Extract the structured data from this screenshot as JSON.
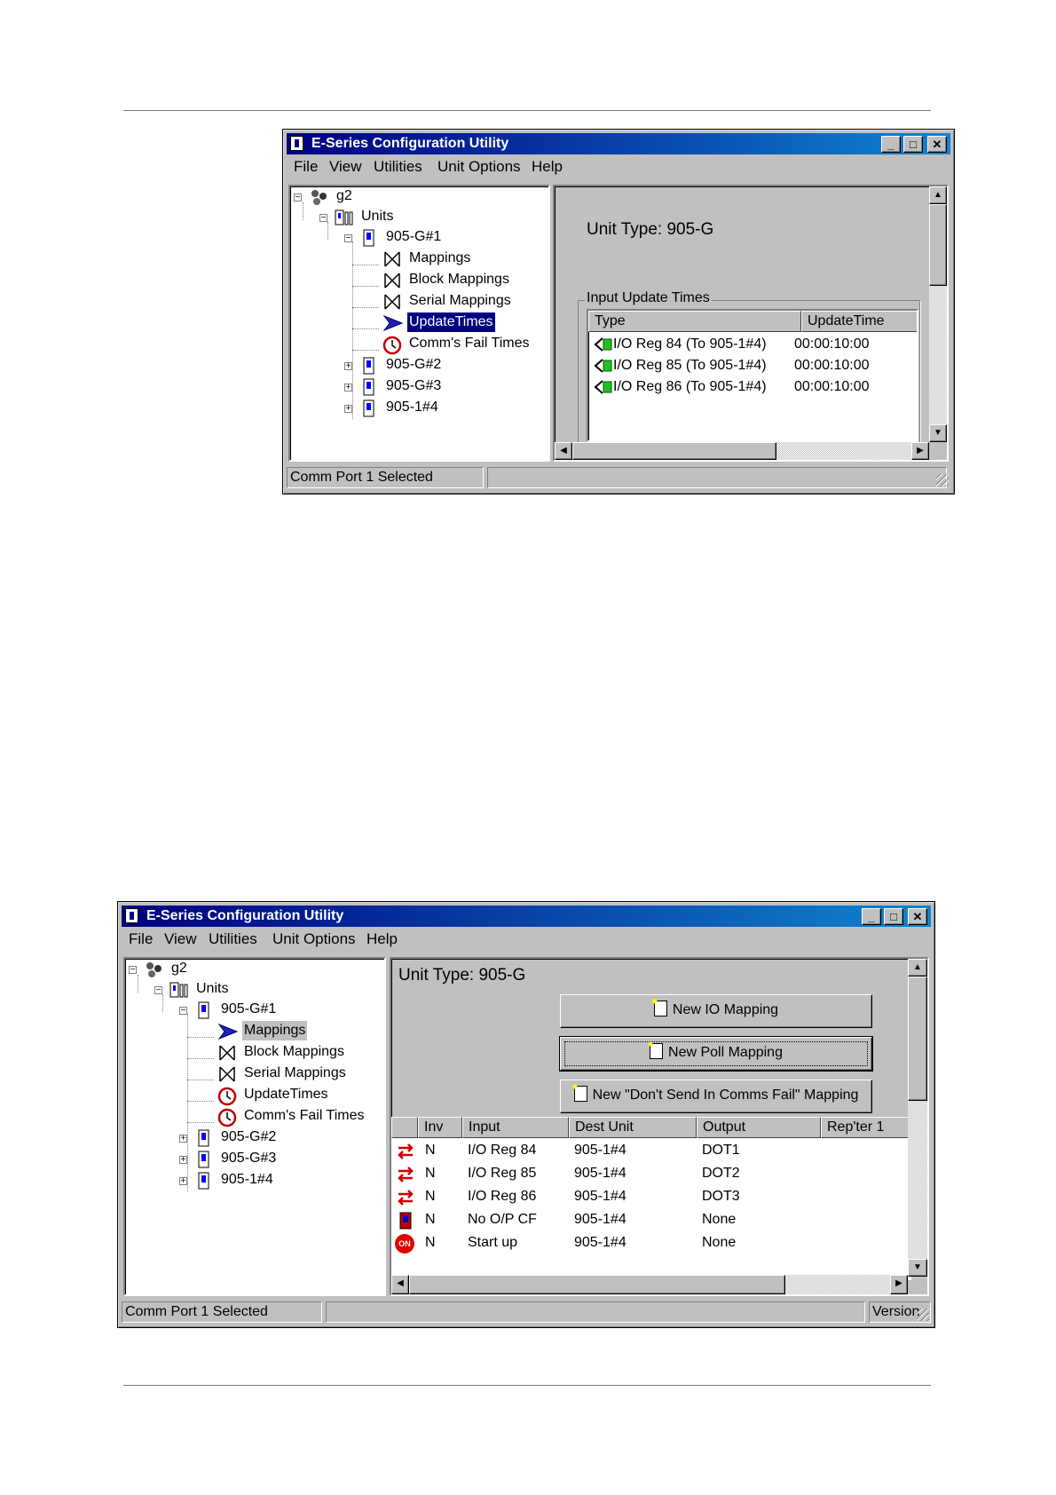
{
  "window_title": "E-Series Configuration Utility",
  "menu": [
    "File",
    "View",
    "Utilities",
    "Unit Options",
    "Help"
  ],
  "title_buttons": {
    "minimize": "_",
    "maximize": "□",
    "close": "✕"
  },
  "tree": {
    "root": "g2",
    "units": "Units",
    "unit1": "905-G#1",
    "children": [
      "Mappings",
      "Block Mappings",
      "Serial Mappings",
      "UpdateTimes",
      "Comm's Fail Times"
    ],
    "others": [
      "905-G#2",
      "905-G#3",
      "905-1#4"
    ]
  },
  "status": {
    "left": "Comm Port 1 Selected",
    "version": "Version"
  },
  "screen1": {
    "selected_node": "UpdateTimes",
    "unit_type": "Unit Type:  905-G",
    "group_title": "Input Update Times",
    "columns": [
      "Type",
      "UpdateTime"
    ],
    "rows": [
      {
        "type": "I/O Reg 84  (To 905-1#4)",
        "time": "00:00:10:00"
      },
      {
        "type": "I/O Reg 85  (To 905-1#4)",
        "time": "00:00:10:00"
      },
      {
        "type": "I/O Reg 86  (To 905-1#4)",
        "time": "00:00:10:00"
      }
    ]
  },
  "screen2": {
    "selected_node": "Mappings",
    "unit_type": "Unit Type:   905-G",
    "buttons": [
      "New IO Mapping",
      "New Poll Mapping",
      "New \"Don't Send In Comms Fail\" Mapping"
    ],
    "columns": [
      "",
      "Inv",
      "Input",
      "Dest Unit",
      "Output",
      "Rep'ter 1"
    ],
    "rows": [
      {
        "icon": "io-mapping-icon",
        "inv": "N",
        "input": "I/O Reg 84",
        "dest": "905-1#4",
        "output": "DOT1"
      },
      {
        "icon": "io-mapping-icon",
        "inv": "N",
        "input": "I/O Reg 85",
        "dest": "905-1#4",
        "output": "DOT2"
      },
      {
        "icon": "io-mapping-icon",
        "inv": "N",
        "input": "I/O Reg 86",
        "dest": "905-1#4",
        "output": "DOT3"
      },
      {
        "icon": "unit-icon",
        "inv": "N",
        "input": "No O/P CF",
        "dest": "905-1#4",
        "output": "None"
      },
      {
        "icon": "on-icon",
        "inv": "N",
        "input": "Start up",
        "dest": "905-1#4",
        "output": "None",
        "badge": "ON"
      }
    ]
  }
}
